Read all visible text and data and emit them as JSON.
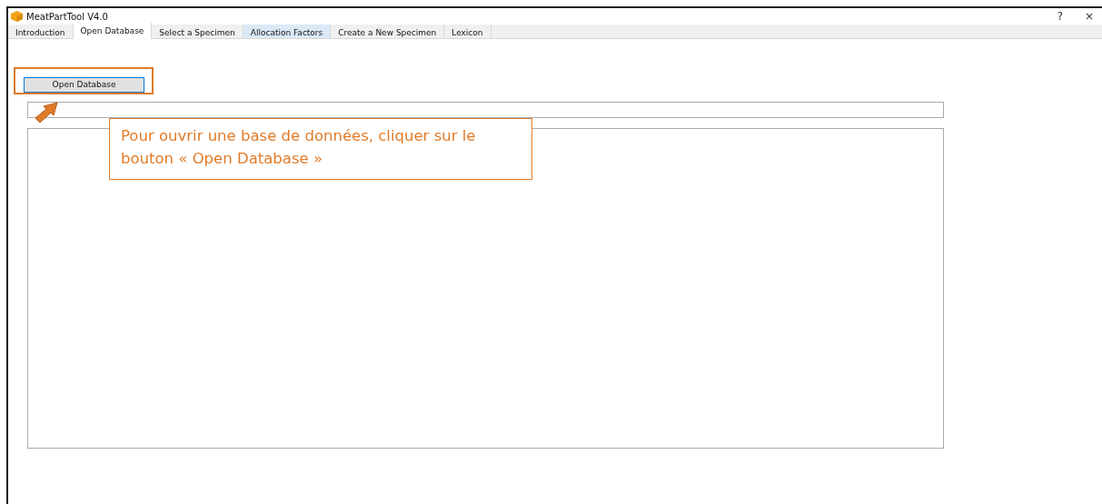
{
  "window": {
    "title": "MeatPartTool V4.0",
    "help": "?",
    "close": "×"
  },
  "tabs": [
    {
      "label": "Introduction",
      "selected": false,
      "hovered": false
    },
    {
      "label": "Open Database",
      "selected": true,
      "hovered": false
    },
    {
      "label": "Select a Specimen",
      "selected": false,
      "hovered": false
    },
    {
      "label": "Allocation Factors",
      "selected": false,
      "hovered": true
    },
    {
      "label": "Create a New Specimen",
      "selected": false,
      "hovered": false
    },
    {
      "label": "Lexicon",
      "selected": false,
      "hovered": false
    }
  ],
  "open_button": {
    "label": "Open Database"
  },
  "annotation": {
    "text": "Pour ouvrir une base de données, cliquer sur le bouton « Open Database »"
  }
}
